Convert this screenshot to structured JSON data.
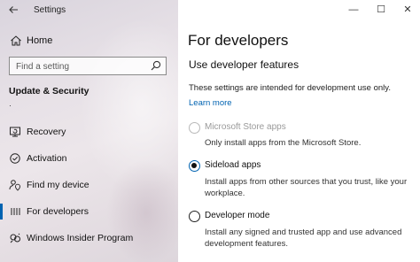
{
  "window": {
    "title": "Settings",
    "controls": {
      "minimize": "—",
      "maximize": "☐",
      "close": "✕"
    }
  },
  "sidebar": {
    "home_label": "Home",
    "search_placeholder": "Find a setting",
    "section_heading": "Update & Security",
    "section_marker": "·",
    "items": [
      {
        "label": "Recovery",
        "icon": "recovery-icon"
      },
      {
        "label": "Activation",
        "icon": "activation-icon"
      },
      {
        "label": "Find my device",
        "icon": "person-location-icon"
      },
      {
        "label": "For developers",
        "icon": "developers-icon",
        "selected": true
      },
      {
        "label": "Windows Insider Program",
        "icon": "insider-icon"
      }
    ]
  },
  "main": {
    "title": "For developers",
    "subtitle": "Use developer features",
    "description": "These settings are intended for development use only.",
    "learn_more": "Learn more",
    "options": [
      {
        "label": "Microsoft Store apps",
        "description_lines": [
          "Only install apps from the Microsoft Store."
        ],
        "state": "disabled"
      },
      {
        "label": "Sideload apps",
        "description_lines": [
          "Install apps from other sources that you trust, like your",
          "workplace."
        ],
        "state": "checked"
      },
      {
        "label": "Developer mode",
        "description_lines": [
          "Install any signed and trusted app and use advanced",
          "development features."
        ],
        "state": "unchecked"
      }
    ]
  },
  "colors": {
    "accent": "#0063b1"
  }
}
